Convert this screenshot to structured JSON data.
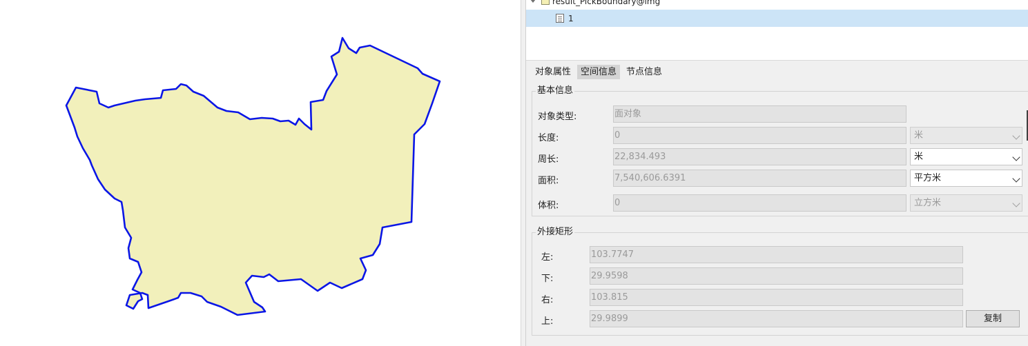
{
  "tree": {
    "layer_name": "result_PickBoundary@img",
    "item_label": "1"
  },
  "tabs": [
    "对象属性",
    "空间信息",
    "节点信息"
  ],
  "basic_info": {
    "title": "基本信息",
    "object_type_label": "对象类型:",
    "object_type_value": "面对象",
    "length_label": "长度:",
    "length_value": "0",
    "length_unit": "米",
    "perimeter_label": "周长:",
    "perimeter_value": "22,834.493",
    "perimeter_unit": "米",
    "area_label": "面积:",
    "area_value": "7,540,606.6391",
    "area_unit": "平方米",
    "volume_label": "体积:",
    "volume_value": "0",
    "volume_unit": "立方米"
  },
  "bbox": {
    "title": "外接矩形",
    "left_label": "左:",
    "left_value": "103.7747",
    "bottom_label": "下:",
    "bottom_value": "29.9598",
    "right_label": "右:",
    "right_value": "103.815",
    "top_label": "上:",
    "top_value": "29.9899",
    "copy_button": "复制"
  },
  "map": {
    "polygon_fill": "#f2f0bb",
    "polygon_stroke": "#0a16e6"
  }
}
